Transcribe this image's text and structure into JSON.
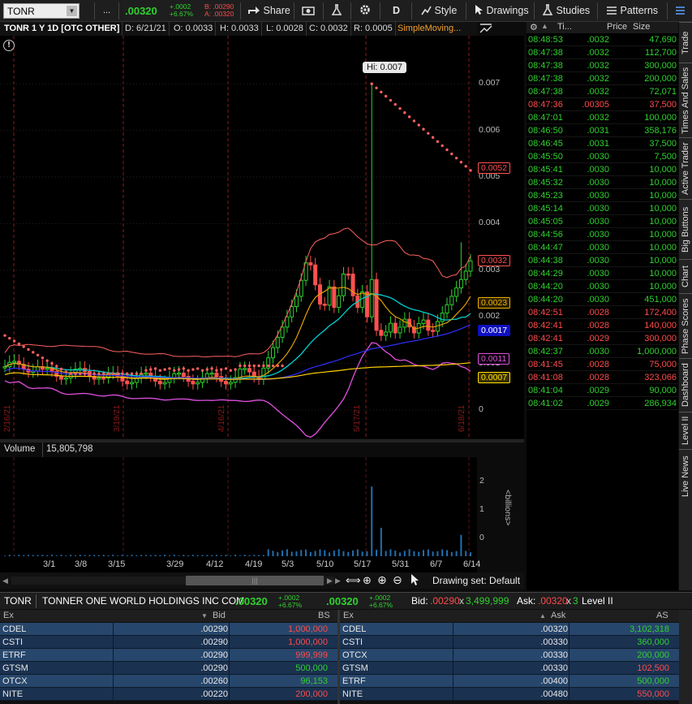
{
  "toolbar": {
    "symbol": "TONR",
    "more": "...",
    "last": ".00320",
    "net_change": "+.0002",
    "pct_change": "+6.67%",
    "bid_label": "B: .00290",
    "ask_label": "A: .00320",
    "share": "Share",
    "period": "D",
    "style": "Style",
    "drawings": "Drawings",
    "studies": "Studies",
    "patterns": "Patterns"
  },
  "chart_header": {
    "title": "TONR 1 Y 1D [OTC OTHER]",
    "date": "D: 6/21/21",
    "open": "O: 0.0033",
    "high": "H: 0.0033",
    "low": "L: 0.0028",
    "close": "C: 0.0032",
    "range": "R: 0.0005",
    "study": "SimpleMoving..."
  },
  "chart": {
    "hi_label": "Hi: 0.007",
    "axis_ticks": [
      "0.007",
      "0.006",
      "0.005",
      "0.004",
      "0.003",
      "0.002",
      "0.001",
      "0"
    ],
    "tags": [
      {
        "text": "0.0052",
        "bg": "#000000",
        "fg": "#ff5050",
        "border": "#ff5050"
      },
      {
        "text": "0.0032",
        "bg": "#000000",
        "fg": "#ff5050",
        "border": "#ff5050"
      },
      {
        "text": "0.0023",
        "bg": "#2a2000",
        "fg": "#f0b000",
        "border": "#f0b000"
      },
      {
        "text": "0.0017",
        "bg": "#1010c0",
        "fg": "#ffffff",
        "border": "#1010c0"
      },
      {
        "text": "0.0011",
        "bg": "#000000",
        "fg": "#e050e0",
        "border": "#e050e0"
      },
      {
        "text": "0.0007",
        "bg": "#3a3000",
        "fg": "#ffe000",
        "border": "#ffe000"
      }
    ],
    "vertical_date_labels": [
      "2/16/21",
      "3/19/21",
      "4/16/21",
      "5/17/21",
      "6/18/21"
    ],
    "colors": {
      "up": "#2fd12f",
      "down": "#ff5050",
      "bb": "#ff6060",
      "ema": "#00d0d0",
      "sma_slow": "#ffd000",
      "sma_mid": "#e0a000",
      "sma_blue": "#3030ff",
      "lower": "#e050e0"
    }
  },
  "volume": {
    "label": "Volume",
    "value": "15,805,798",
    "axis_ticks": [
      "2",
      "1",
      "0"
    ],
    "unit": "<billions>"
  },
  "dates": [
    "3/1",
    "3/8",
    "3/15",
    "3/29",
    "4/12",
    "4/19",
    "5/3",
    "5/10",
    "5/17",
    "5/31",
    "6/7",
    "6/14"
  ],
  "scroll": {
    "drawing_set": "Drawing set: Default"
  },
  "time_sales": {
    "headers": [
      "Ti...",
      "Price",
      "Size"
    ],
    "rows": [
      {
        "t": "08:48:53",
        "p": ".0032",
        "s": "47,690",
        "c": "g"
      },
      {
        "t": "08:47:38",
        "p": ".0032",
        "s": "112,700",
        "c": "g"
      },
      {
        "t": "08:47:38",
        "p": ".0032",
        "s": "300,000",
        "c": "g"
      },
      {
        "t": "08:47:38",
        "p": ".0032",
        "s": "200,000",
        "c": "g"
      },
      {
        "t": "08:47:38",
        "p": ".0032",
        "s": "72,071",
        "c": "g"
      },
      {
        "t": "08:47:36",
        "p": ".00305",
        "s": "37,500",
        "c": "r"
      },
      {
        "t": "08:47:01",
        "p": ".0032",
        "s": "100,000",
        "c": "g"
      },
      {
        "t": "08:46:50",
        "p": ".0031",
        "s": "358,176",
        "c": "g"
      },
      {
        "t": "08:46:45",
        "p": ".0031",
        "s": "37,500",
        "c": "g"
      },
      {
        "t": "08:45:50",
        "p": ".0030",
        "s": "7,500",
        "c": "g"
      },
      {
        "t": "08:45:41",
        "p": ".0030",
        "s": "10,000",
        "c": "g"
      },
      {
        "t": "08:45:32",
        "p": ".0030",
        "s": "10,000",
        "c": "g"
      },
      {
        "t": "08:45:23",
        "p": ".0030",
        "s": "10,000",
        "c": "g"
      },
      {
        "t": "08:45:14",
        "p": ".0030",
        "s": "10,000",
        "c": "g"
      },
      {
        "t": "08:45:05",
        "p": ".0030",
        "s": "10,000",
        "c": "g"
      },
      {
        "t": "08:44:56",
        "p": ".0030",
        "s": "10,000",
        "c": "g"
      },
      {
        "t": "08:44:47",
        "p": ".0030",
        "s": "10,000",
        "c": "g"
      },
      {
        "t": "08:44:38",
        "p": ".0030",
        "s": "10,000",
        "c": "g"
      },
      {
        "t": "08:44:29",
        "p": ".0030",
        "s": "10,000",
        "c": "g"
      },
      {
        "t": "08:44:20",
        "p": ".0030",
        "s": "10,000",
        "c": "g"
      },
      {
        "t": "08:44:20",
        "p": ".0030",
        "s": "451,000",
        "c": "g"
      },
      {
        "t": "08:42:51",
        "p": ".0028",
        "s": "172,400",
        "c": "r"
      },
      {
        "t": "08:42:41",
        "p": ".0028",
        "s": "140,000",
        "c": "r"
      },
      {
        "t": "08:42:41",
        "p": ".0029",
        "s": "300,000",
        "c": "r"
      },
      {
        "t": "08:42:37",
        "p": ".0030",
        "s": "1,000,000",
        "c": "g"
      },
      {
        "t": "08:41:45",
        "p": ".0028",
        "s": "75,000",
        "c": "r"
      },
      {
        "t": "08:41:08",
        "p": ".0028",
        "s": "323,066",
        "c": "r"
      },
      {
        "t": "08:41:04",
        "p": ".0029",
        "s": "90,000",
        "c": "g"
      },
      {
        "t": "08:41:02",
        "p": ".0029",
        "s": "286,934",
        "c": "g"
      }
    ]
  },
  "side_tabs": [
    "Trade",
    "Times And Sales",
    "Active Trader",
    "Big Buttons",
    "Chart",
    "Phase Scores",
    "Dashboard",
    "Level II",
    "Live News"
  ],
  "level2": {
    "symbol": "TONR",
    "company": "TONNER ONE WORLD HOLDINGS INC COM",
    "last": ".00320",
    "net_change": "+.0002",
    "pct_change": "+6.67%",
    "last2": ".00320",
    "net_change2": "+.0002",
    "pct_change2": "+6.67%",
    "bid_label": "Bid:",
    "bid": ".00290",
    "bid_size": "3,499,999",
    "ask_label": "Ask:",
    "ask": ".00320",
    "ask_size": "3",
    "title": "Level II",
    "bid_headers": [
      "Ex",
      "Bid",
      "BS"
    ],
    "ask_headers": [
      "Ex",
      "Ask",
      "AS"
    ],
    "bids": [
      {
        "ex": "CDEL",
        "price": ".00290",
        "size": "1,000,000",
        "c": "r"
      },
      {
        "ex": "CSTI",
        "price": ".00290",
        "size": "1,000,000",
        "c": "r"
      },
      {
        "ex": "ETRF",
        "price": ".00290",
        "size": "999,999",
        "c": "r"
      },
      {
        "ex": "GTSM",
        "price": ".00290",
        "size": "500,000",
        "c": "g"
      },
      {
        "ex": "OTCX",
        "price": ".00260",
        "size": "96,153",
        "c": "g"
      },
      {
        "ex": "NITE",
        "price": ".00220",
        "size": "200,000",
        "c": "r"
      }
    ],
    "asks": [
      {
        "ex": "CDEL",
        "price": ".00320",
        "size": "3,102,318",
        "c": "g"
      },
      {
        "ex": "CSTI",
        "price": ".00330",
        "size": "360,000",
        "c": "g"
      },
      {
        "ex": "OTCX",
        "price": ".00330",
        "size": "200,000",
        "c": "g"
      },
      {
        "ex": "GTSM",
        "price": ".00330",
        "size": "102,500",
        "c": "r"
      },
      {
        "ex": "ETRF",
        "price": ".00400",
        "size": "500,000",
        "c": "g"
      },
      {
        "ex": "NITE",
        "price": ".00480",
        "size": "550,000",
        "c": "r"
      }
    ]
  }
}
